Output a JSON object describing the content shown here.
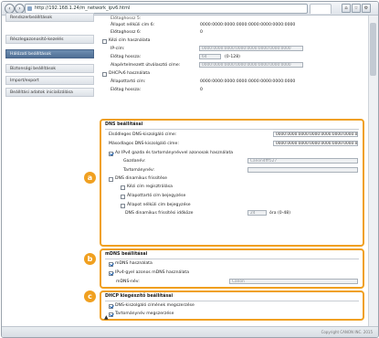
{
  "browser": {
    "url": "http://192.168.1.24/m_network_ipv6.html",
    "back_icon": "arrow-left-icon",
    "forward_icon": "arrow-right-icon"
  },
  "sidebar": {
    "items": [
      {
        "label": "Rendszerbeállítások"
      },
      {
        "label": "Részlegazonosító-kezelés"
      },
      {
        "label": "Hálózati beállítások"
      },
      {
        "label": "Biztonsági beállítások"
      },
      {
        "label": "Import/export"
      },
      {
        "label": "Beállítási adatok inicializálása"
      }
    ]
  },
  "ipv6": {
    "line0": "Előtaghossz 5:",
    "addr6_label": "Állapot nélküli cím 6:",
    "addr6_value": "0000:0000:0000:0000:0000:0000:0000:0000",
    "prefix6_label": "Előtaghossz 6:",
    "prefix6_value": "0",
    "manual_label": "Kézi cím használata",
    "ip_label": "IP-cím:",
    "ip_value": "0000:0000:0000:0000:0000:0000:0000:0000",
    "prefixlen_label": "Előtag hossza:",
    "prefixlen_value": "64",
    "prefixlen_range": "(0-128)",
    "gateway_label": "Alapértelmezett útválasztó címe:",
    "gateway_value": "0000:0000:0000:0000:0000:0000:0000:0000",
    "dhcp_label": "DHCPv6 használata",
    "stateful_label": "Állapottartó cím:",
    "stateful_value": "0000:0000:0000:0000:0000:0000:0000:0000",
    "prefix_label": "Előtag hossza:",
    "prefix_value": "0"
  },
  "dns": {
    "title": "DNS beállításai",
    "primary_label": "Elsődleges DNS-kiszolgáló címe:",
    "primary_value": "0000:0000:0000:0000:0000:0000:0000:0000",
    "secondary_label": "Másodlagos DNS-kiszolgáló címe:",
    "secondary_value": "0000:0000:0000:0000:0000:0000:0000:0000",
    "same_host_label": "Az IPv4 gazda és tartománynévvel azonosak használata",
    "host_label": "Gazdanév:",
    "host_value": "Canon4fff527",
    "domain_label": "Tartománynév:",
    "domain_value": "",
    "dynamic_label": "DNS dinamikus frissítése",
    "manual_reg_label": "Kézi cím regisztrálása",
    "stateful_reg_label": "Állapottartó cím bejegyzése",
    "stateless_reg_label": "Állapot nélküli cím bejegyzése",
    "interval_label": "DNS dinamikus frissítési időköze",
    "interval_value": "24",
    "interval_unit": "óra (0-48)",
    "badge": "a"
  },
  "mdns": {
    "title": "mDNS beállításai",
    "use_label": "mDNS használata",
    "same_label": "IPv4-gyel azonos mDNS használata",
    "name_label": "mDNS-név:",
    "name_value": "Canon",
    "badge": "b"
  },
  "dhcp": {
    "title": "DHCP kiegészítő beállításai",
    "dns_server_label": "DNS-kiszolgáló címének megszerzése",
    "domain_label": "Tartománynév megszerzése",
    "badge": "c"
  },
  "footer": {
    "top_icon": "arrow-up-icon",
    "copyright": "Copyright CANON INC. 2015"
  }
}
